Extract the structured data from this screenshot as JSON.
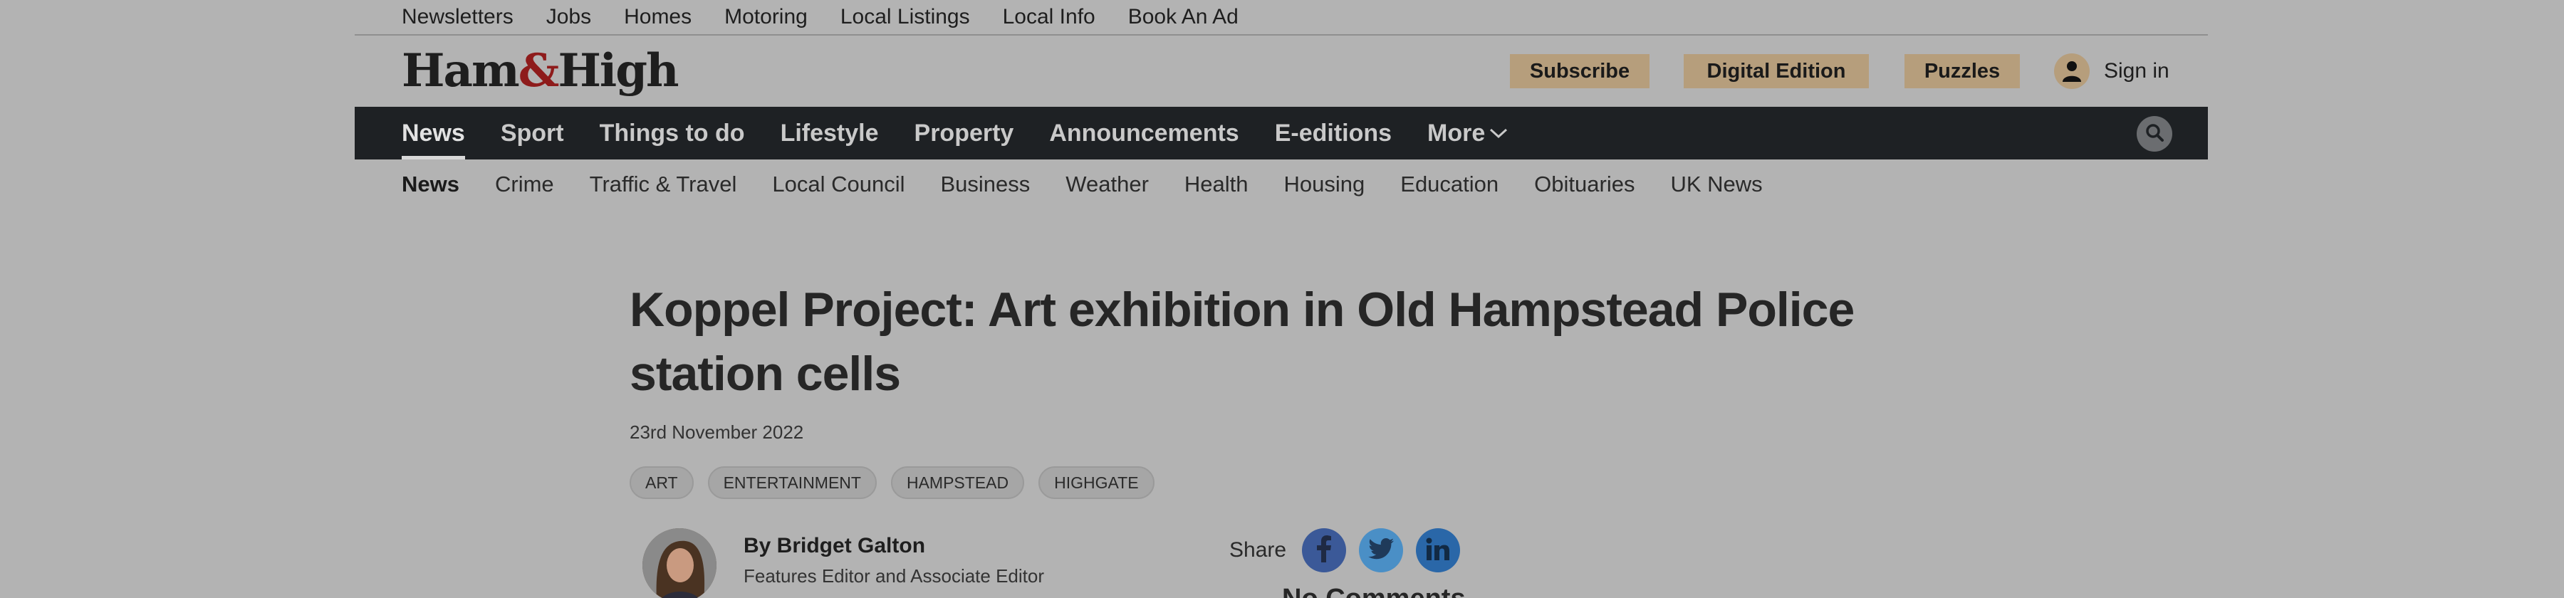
{
  "utility_nav": [
    "Newsletters",
    "Jobs",
    "Homes",
    "Motoring",
    "Local Listings",
    "Local Info",
    "Book An Ad"
  ],
  "masthead": {
    "logo_parts": [
      "Ham",
      "&",
      "High"
    ],
    "buttons": [
      "Subscribe",
      "Digital Edition",
      "Puzzles"
    ],
    "signin_label": "Sign in",
    "user_icon": "user-icon",
    "accent_color": "#b69e7c"
  },
  "main_nav": {
    "items": [
      "News",
      "Sport",
      "Things to do",
      "Lifestyle",
      "Property",
      "Announcements",
      "E-editions",
      "More"
    ],
    "active": "News",
    "search_icon": "search-icon"
  },
  "sub_nav": {
    "items": [
      "News",
      "Crime",
      "Traffic & Travel",
      "Local Council",
      "Business",
      "Weather",
      "Health",
      "Housing",
      "Education",
      "Obituaries",
      "UK News"
    ],
    "active": "News"
  },
  "article": {
    "headline": "Koppel Project: Art exhibition in Old Hampstead Police station cells",
    "date": "23rd November 2022",
    "tags": [
      "ART",
      "ENTERTAINMENT",
      "HAMPSTEAD",
      "HIGHGATE"
    ],
    "author": {
      "name": "By Bridget Galton",
      "role": "Features Editor and Associate Editor"
    },
    "share": {
      "label": "Share",
      "networks": [
        {
          "icon": "facebook-icon",
          "color": "#3b5998"
        },
        {
          "icon": "twitter-icon",
          "color": "#4a8fc6"
        },
        {
          "icon": "linkedin-icon",
          "color": "#2a67a8"
        }
      ]
    },
    "comments_label": "No Comments"
  }
}
